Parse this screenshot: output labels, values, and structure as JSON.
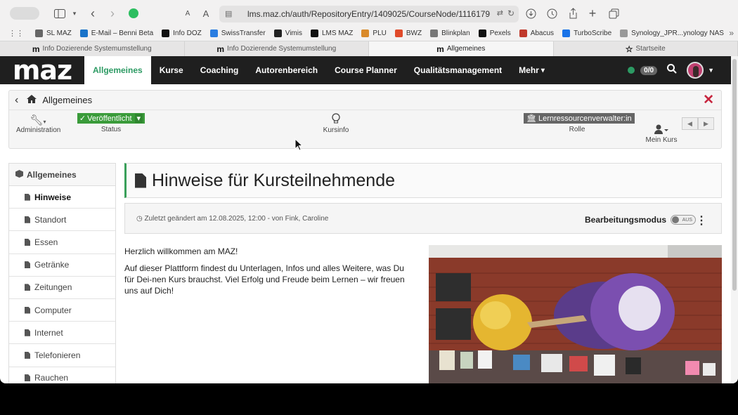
{
  "browser": {
    "url": "lms.maz.ch/auth/RepositoryEntry/1409025/CourseNode/111617935855",
    "favorites": [
      {
        "label": "SL MAZ",
        "color": "#666666"
      },
      {
        "label": "E-Mail – Benni Beta",
        "color": "#1a73c9"
      },
      {
        "label": "Info DOZ",
        "color": "#111111"
      },
      {
        "label": "SwissTransfer",
        "color": "#2a7de1"
      },
      {
        "label": "Vimis",
        "color": "#222222"
      },
      {
        "label": "LMS MAZ",
        "color": "#111111"
      },
      {
        "label": "PLU",
        "color": "#d98a2b"
      },
      {
        "label": "BWZ",
        "color": "#e04a2a"
      },
      {
        "label": "Blinkplan",
        "color": "#777777"
      },
      {
        "label": "Pexels",
        "color": "#111111"
      },
      {
        "label": "Abacus",
        "color": "#c0392b"
      },
      {
        "label": "TurboScribe",
        "color": "#1a73e8"
      },
      {
        "label": "Synology_JPR...ynology NAS",
        "color": "#999999"
      }
    ],
    "tabs": [
      {
        "label": "Info Dozierende Systemumstellung",
        "active": false
      },
      {
        "label": "Info Dozierende Systemumstellung",
        "active": false
      },
      {
        "label": "Allgemeines",
        "active": true
      },
      {
        "label": "Startseite",
        "active": false
      }
    ]
  },
  "app": {
    "logo": "maz",
    "nav": [
      {
        "label": "Allgemeines",
        "active": true
      },
      {
        "label": "Kurse",
        "active": false
      },
      {
        "label": "Coaching",
        "active": false
      },
      {
        "label": "Autorenbereich",
        "active": false
      },
      {
        "label": "Course Planner",
        "active": false
      },
      {
        "label": "Qualitätsmanagement",
        "active": false
      },
      {
        "label": "Mehr",
        "active": false
      }
    ],
    "counter": "0/0",
    "accent": "#2c9a63"
  },
  "course": {
    "title": "Allgemeines",
    "tools": {
      "administration": "Administration",
      "status_value": "Veröffentlicht",
      "status_label": "Status",
      "kursinfo": "Kursinfo",
      "role_value": "Lernressourcenverwalter:in",
      "role_label": "Rolle",
      "mein_kurs": "Mein Kurs"
    }
  },
  "menu": {
    "header": "Allgemeines",
    "items": [
      {
        "label": "Hinweise",
        "active": true
      },
      {
        "label": "Standort",
        "active": false
      },
      {
        "label": "Essen",
        "active": false
      },
      {
        "label": "Getränke",
        "active": false
      },
      {
        "label": "Zeitungen",
        "active": false
      },
      {
        "label": "Computer",
        "active": false
      },
      {
        "label": "Internet",
        "active": false
      },
      {
        "label": "Telefonieren",
        "active": false
      },
      {
        "label": "Rauchen",
        "active": false
      }
    ]
  },
  "page": {
    "title": "Hinweise für Kursteilnehmende",
    "changed": "Zuletzt geändert am 12.08.2025, 12:00 - von Fink, Caroline",
    "edit_mode_label": "Bearbeitungsmodus",
    "toggle_text": "AUS",
    "greeting": "Herzlich willkommen am MAZ!",
    "intro": "Auf dieser Plattform findest du Unterlagen, Infos und alles Weitere, was Du für Dei-nen Kurs brauchst. Viel Erfolg und Freude beim Lernen – wir freuen uns auf Dich!"
  }
}
